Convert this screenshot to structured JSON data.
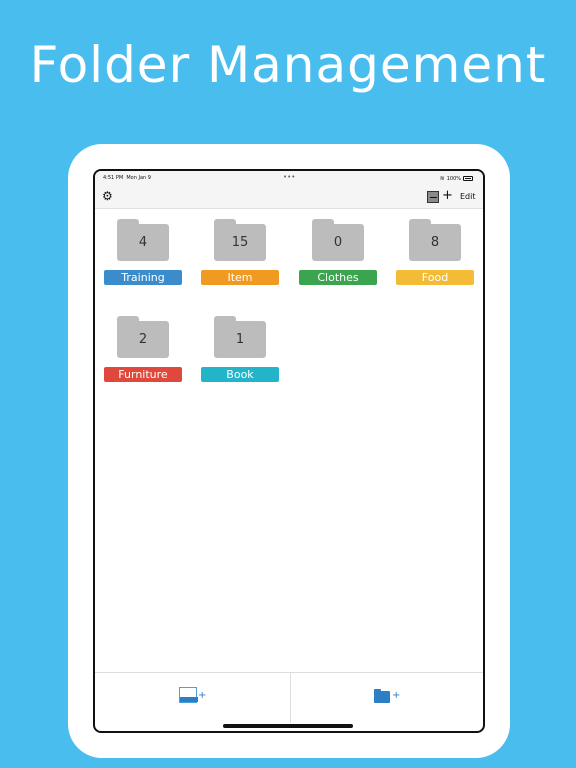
{
  "headline": "Folder Management",
  "status": {
    "time": "4:51 PM",
    "date": "Mon Jan 9",
    "battery": "100%"
  },
  "navbar": {
    "edit_label": "Edit",
    "add_label": "+"
  },
  "folders": [
    {
      "name": "Training",
      "count": "4",
      "color": "#3A8CCB"
    },
    {
      "name": "Item",
      "count": "15",
      "color": "#F09A22"
    },
    {
      "name": "Clothes",
      "count": "0",
      "color": "#3BA44E"
    },
    {
      "name": "Food",
      "count": "8",
      "color": "#F4BC36"
    },
    {
      "name": "Furniture",
      "count": "2",
      "color": "#E0483C"
    },
    {
      "name": "Book",
      "count": "1",
      "color": "#22B4C8"
    }
  ],
  "toolbar": {
    "plus_glyph": "+"
  }
}
